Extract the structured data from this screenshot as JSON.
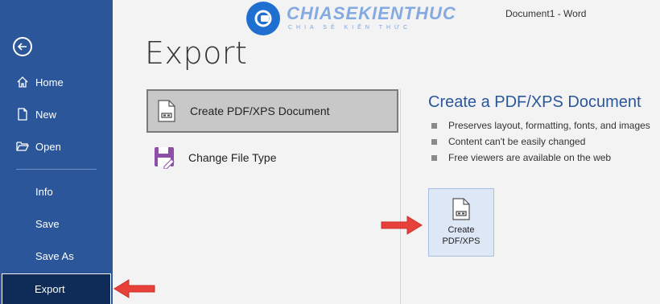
{
  "window": {
    "document_title": "Document1  -  Word"
  },
  "watermark": {
    "name": "CHIASEKIENTHUC",
    "tagline": "CHIA SẺ KIẾN THỨC"
  },
  "page": {
    "title": "Export"
  },
  "sidebar": {
    "back_icon": "back-arrow-icon",
    "items": [
      {
        "label": "Home",
        "icon": "home-icon"
      },
      {
        "label": "New",
        "icon": "new-document-icon"
      },
      {
        "label": "Open",
        "icon": "folder-open-icon"
      },
      {
        "label": "Info"
      },
      {
        "label": "Save"
      },
      {
        "label": "Save As"
      },
      {
        "label": "Export",
        "active": true
      }
    ]
  },
  "export_options": [
    {
      "label": "Create PDF/XPS Document",
      "icon": "pdf-document-icon",
      "selected": true
    },
    {
      "label": "Change File Type",
      "icon": "file-type-icon",
      "selected": false
    }
  ],
  "panel": {
    "title": "Create a PDF/XPS Document",
    "bullets": [
      "Preserves layout, formatting, fonts, and images",
      "Content can't be easily changed",
      "Free viewers are available on the web"
    ],
    "button": {
      "line1": "Create",
      "line2": "PDF/XPS",
      "icon": "pdf-document-icon"
    }
  },
  "colors": {
    "sidebar": "#2b579a",
    "active": "#0f2c59",
    "accent": "#2b579a",
    "arrow": "#e8413a"
  }
}
